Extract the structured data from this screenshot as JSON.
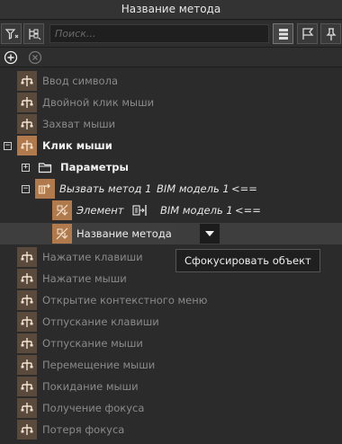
{
  "title": "Название метода",
  "search": {
    "placeholder": "Поиск..."
  },
  "tree": {
    "events_before": [
      "Ввод символа",
      "Двойной клик мыши",
      "Захват мыши"
    ],
    "click_node": "Клик мыши",
    "params_node": "Параметры",
    "call_method": {
      "label": "Вызвать метод 1",
      "model": "BIM модель 1",
      "arrow": "<=="
    },
    "element_row": {
      "label": "Элемент",
      "model": "BIM модель 1",
      "arrow": "<=="
    },
    "method_name_row": {
      "label": "Название метода"
    },
    "events_after": [
      "Нажатие клавиши",
      "Нажатие мыши",
      "Открытие контекстного меню",
      "Отпускание клавиши",
      "Отпускание мыши",
      "Перемещение мыши",
      "Покидание мыши",
      "Получение фокуса",
      "Потеря фокуса"
    ]
  },
  "tooltip": "Сфокусировать объект",
  "colors": {
    "icon": "#8a6a4a",
    "icon_dim": "#5a4a3c",
    "icon_active": "#b07a4c",
    "background": "#2b2b2b"
  },
  "icons": {
    "toolbar": [
      "filter-icon",
      "tree-collapse-icon",
      "list-view-icon",
      "flag-icon",
      "pin-icon",
      "add-icon",
      "remove-icon"
    ],
    "event": "event-flow-icon",
    "folder": "folder-icon",
    "method": "method-call-icon",
    "element": "element-link-icon",
    "focus": "focus-object-icon",
    "dropdown": "chevron-down-icon"
  }
}
